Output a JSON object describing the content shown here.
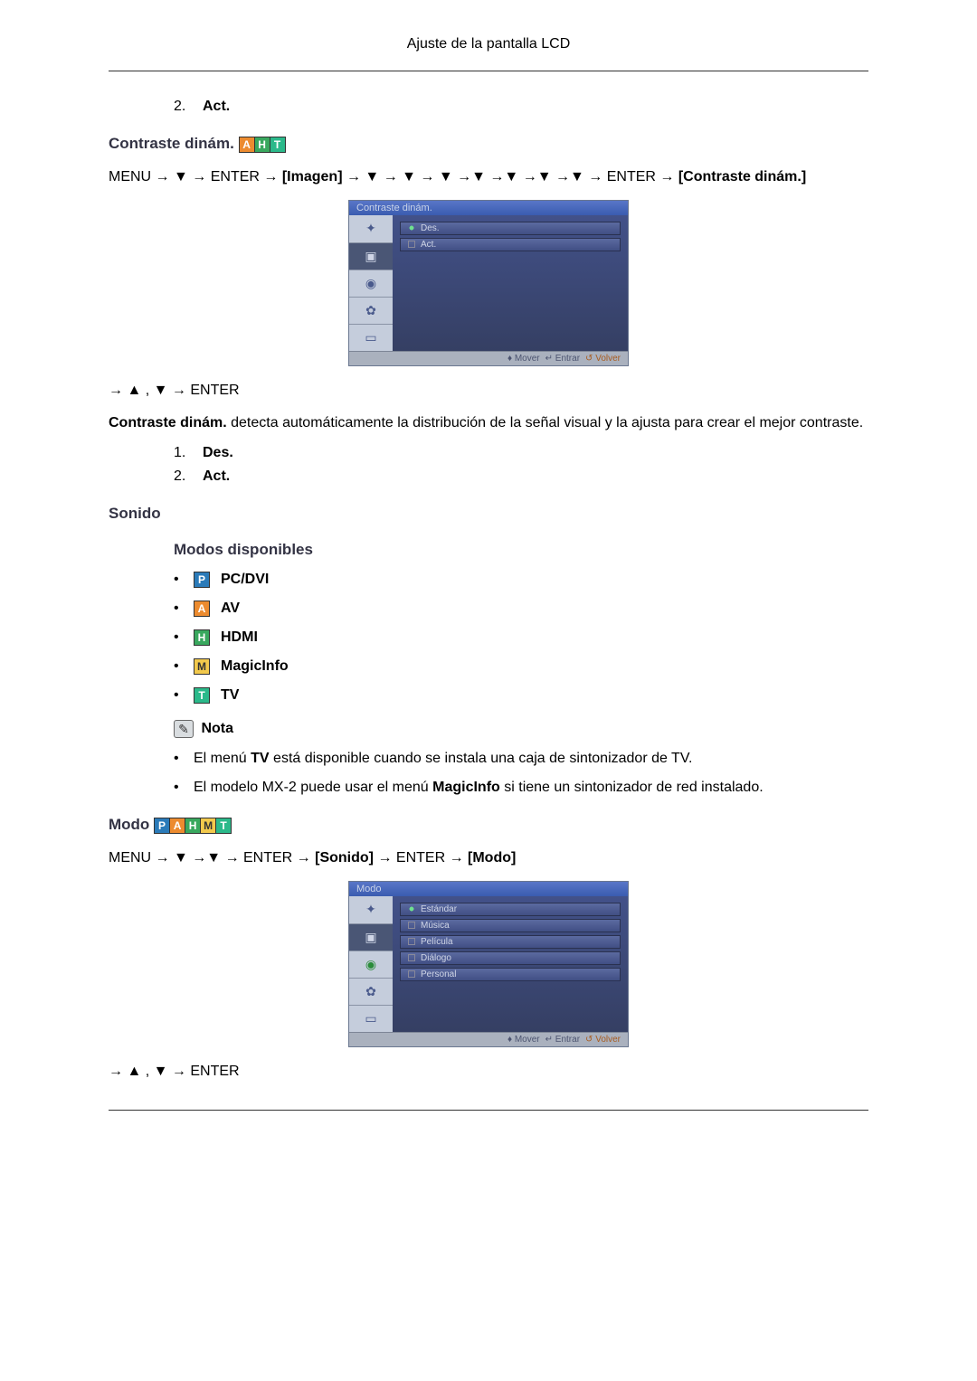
{
  "header": {
    "title": "Ajuste de la pantalla LCD"
  },
  "ol_top": [
    {
      "num": "2.",
      "label": "Act."
    }
  ],
  "section1": {
    "title": "Contraste dinám.",
    "badges": [
      "A",
      "H",
      "T"
    ],
    "path_prefix": "MENU → ▼ → ENTER → ",
    "path_bold1": "[Imagen]",
    "path_mid": " → ▼ → ▼ → ▼ →▼ →▼ →▼ →▼ → ENTER → ",
    "path_bold2": "[Contraste dinám.]",
    "osd": {
      "title": "Contraste dinám.",
      "options": [
        "Des.",
        "Act."
      ],
      "footer": {
        "move": "Mover",
        "enter": "Entrar",
        "return": "Volver"
      }
    },
    "nav2": "→ ▲ , ▼ → ENTER",
    "desc_bold": "Contraste dinám.",
    "desc_rest": " detecta automáticamente la distribución de la señal visual y la ajusta para crear el mejor contraste.",
    "list": [
      {
        "num": "1.",
        "label": "Des."
      },
      {
        "num": "2.",
        "label": "Act."
      }
    ]
  },
  "section2": {
    "title": "Sonido",
    "subtitle": "Modos disponibles",
    "modes": [
      {
        "badge": "P",
        "label": "PC/DVI"
      },
      {
        "badge": "A",
        "label": "AV"
      },
      {
        "badge": "H",
        "label": "HDMI"
      },
      {
        "badge": "M",
        "label": "MagicInfo"
      },
      {
        "badge": "T",
        "label": "TV"
      }
    ],
    "note_label": "Nota",
    "notes": [
      {
        "pre": "El menú ",
        "bold": "TV",
        "post": " está disponible cuando se instala una caja de sintonizador de TV."
      },
      {
        "pre": "El modelo MX-2 puede usar el menú ",
        "bold": "MagicInfo",
        "post": " si tiene un sintonizador de red instalado."
      }
    ]
  },
  "section3": {
    "title": "Modo",
    "badges": [
      "P",
      "A",
      "H",
      "M",
      "T"
    ],
    "path_prefix": "MENU → ▼ →▼ → ENTER → ",
    "path_bold1": "[Sonido]",
    "path_mid": " → ENTER → ",
    "path_bold2": "[Modo]",
    "osd": {
      "title": "Modo",
      "options": [
        "Estándar",
        "Música",
        "Película",
        "Diálogo",
        "Personal"
      ],
      "footer": {
        "move": "Mover",
        "enter": "Entrar",
        "return": "Volver"
      }
    },
    "nav2": "→ ▲ , ▼ → ENTER"
  },
  "icons": {
    "move": "♦",
    "enter": "↵",
    "return": "↺"
  }
}
